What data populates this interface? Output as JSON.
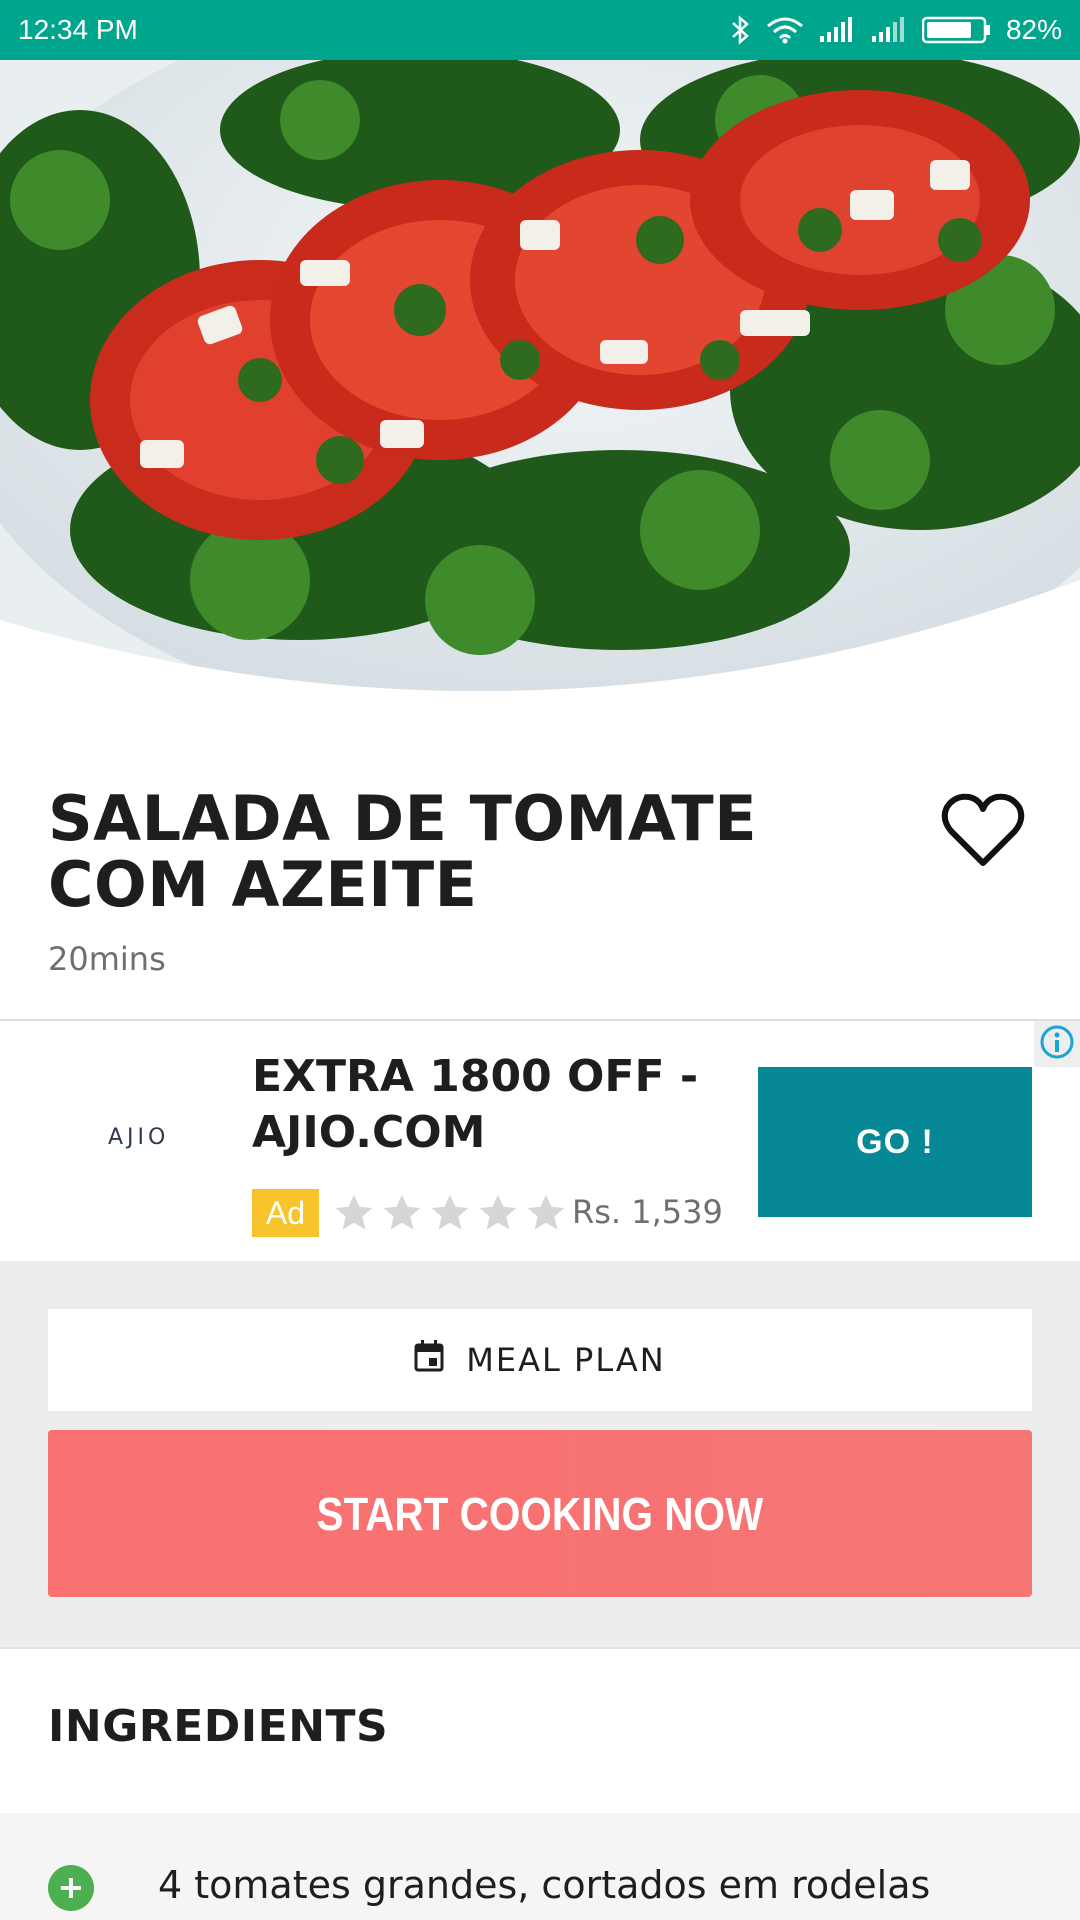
{
  "status_bar": {
    "time": "12:34 PM",
    "battery": "82%",
    "battery_level": 0.82,
    "icons": [
      "bluetooth-icon",
      "wifi-icon",
      "signal-icon",
      "signal-icon",
      "battery-icon"
    ]
  },
  "hero": {
    "image_icon": "recipe-photo"
  },
  "recipe": {
    "title": "SALADA DE TOMATE COM AZEITE",
    "time": "20mins",
    "favorite_icon": "heart-outline-icon"
  },
  "ad": {
    "logo": "AJIO",
    "title": "EXTRA 1800 OFF - AJIO.COM",
    "badge": "Ad",
    "rating": 0,
    "rating_max": 5,
    "price": "Rs. 1,539",
    "cta": "GO !",
    "info_icon": "info-icon"
  },
  "actions": {
    "meal_plan_label": "MEAL PLAN",
    "meal_plan_icon": "calendar-icon",
    "start_cooking_label": "START COOKING NOW"
  },
  "ingredients": {
    "heading": "INGREDIENTS",
    "items": [
      {
        "text": "4 tomates grandes, cortados em rodelas",
        "icon": "add-circle-icon"
      }
    ]
  },
  "colors": {
    "status_bar": "#00A58E",
    "ad_cta": "#078896",
    "start_cooking": "#F97070",
    "ad_badge": "#F7C52B",
    "add_icon": "#4CAF50"
  }
}
